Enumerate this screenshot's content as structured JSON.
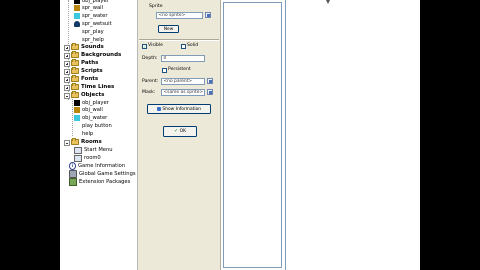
{
  "tree": {
    "sprites": [
      "obj_player",
      "spr_wall",
      "spr_water",
      "spr_wetsuit",
      "spr_play",
      "spr_help"
    ],
    "folders": [
      "Sounds",
      "Backgrounds",
      "Paths",
      "Scripts",
      "Fonts",
      "Time Lines",
      "Objects"
    ],
    "objects": [
      "obj_player",
      "obj_wall",
      "obj_water",
      "play button",
      "help"
    ],
    "rooms_label": "Rooms",
    "rooms": [
      "Start Menu",
      "room0"
    ],
    "extra": [
      "Game Information",
      "Global Game Settings",
      "Extension Packages"
    ]
  },
  "props": {
    "sprite_label": "Sprite",
    "sprite_value": "<no sprite>",
    "new_label": "New",
    "visible_label": "Visible",
    "solid_label": "Solid",
    "depth_label": "Depth:",
    "depth_value": "0",
    "persistent_label": "Persistent",
    "parent_label": "Parent:",
    "parent_value": "<no parent>",
    "mask_label": "Mask:",
    "mask_value": "<same as sprite>",
    "show_info_label": "Show Information",
    "ok_label": "OK"
  },
  "colors": {
    "sprite_black": "#000000",
    "sprite_wall": "#b8860b",
    "sprite_water": "#3cc8e0",
    "sprite_wetsuit": "#123a66"
  }
}
